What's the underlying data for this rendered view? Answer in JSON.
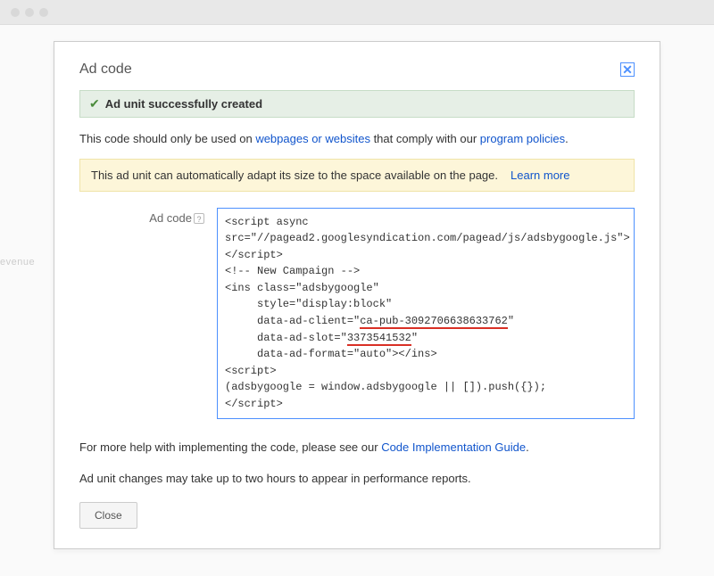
{
  "background": {
    "text": "evenue"
  },
  "modal": {
    "title": "Ad code",
    "success": "Ad unit successfully created",
    "info_pre": "This code should only be used on ",
    "info_link1": "webpages or websites",
    "info_mid": " that comply with our ",
    "info_link2": "program policies",
    "info_post": ".",
    "banner_text": "This ad unit can automatically adapt its size to the space available on the page.",
    "banner_link": "Learn more",
    "code_label": "Ad code",
    "code": {
      "line1": "<script async",
      "line2": "src=\"//pagead2.googlesyndication.com/pagead/js/adsbygoogle.js\">",
      "line3": "</script>",
      "line4": "<!-- New Campaign -->",
      "line5": "<ins class=\"adsbygoogle\"",
      "line6": "     style=\"display:block\"",
      "line7a": "     data-ad-client=\"",
      "line7b": "ca-pub-3092706638633762",
      "line7c": "\"",
      "line8a": "     data-ad-slot=\"",
      "line8b": "3373541532",
      "line8c": "\"",
      "line9": "     data-ad-format=\"auto\"></ins>",
      "line10": "<script>",
      "line11": "(adsbygoogle = window.adsbygoogle || []).push({});",
      "line12": "</script>"
    },
    "help_pre": "For more help with implementing the code, please see our ",
    "help_link": "Code Implementation Guide",
    "help_post": ".",
    "delay_note": "Ad unit changes may take up to two hours to appear in performance reports.",
    "close_button": "Close"
  }
}
